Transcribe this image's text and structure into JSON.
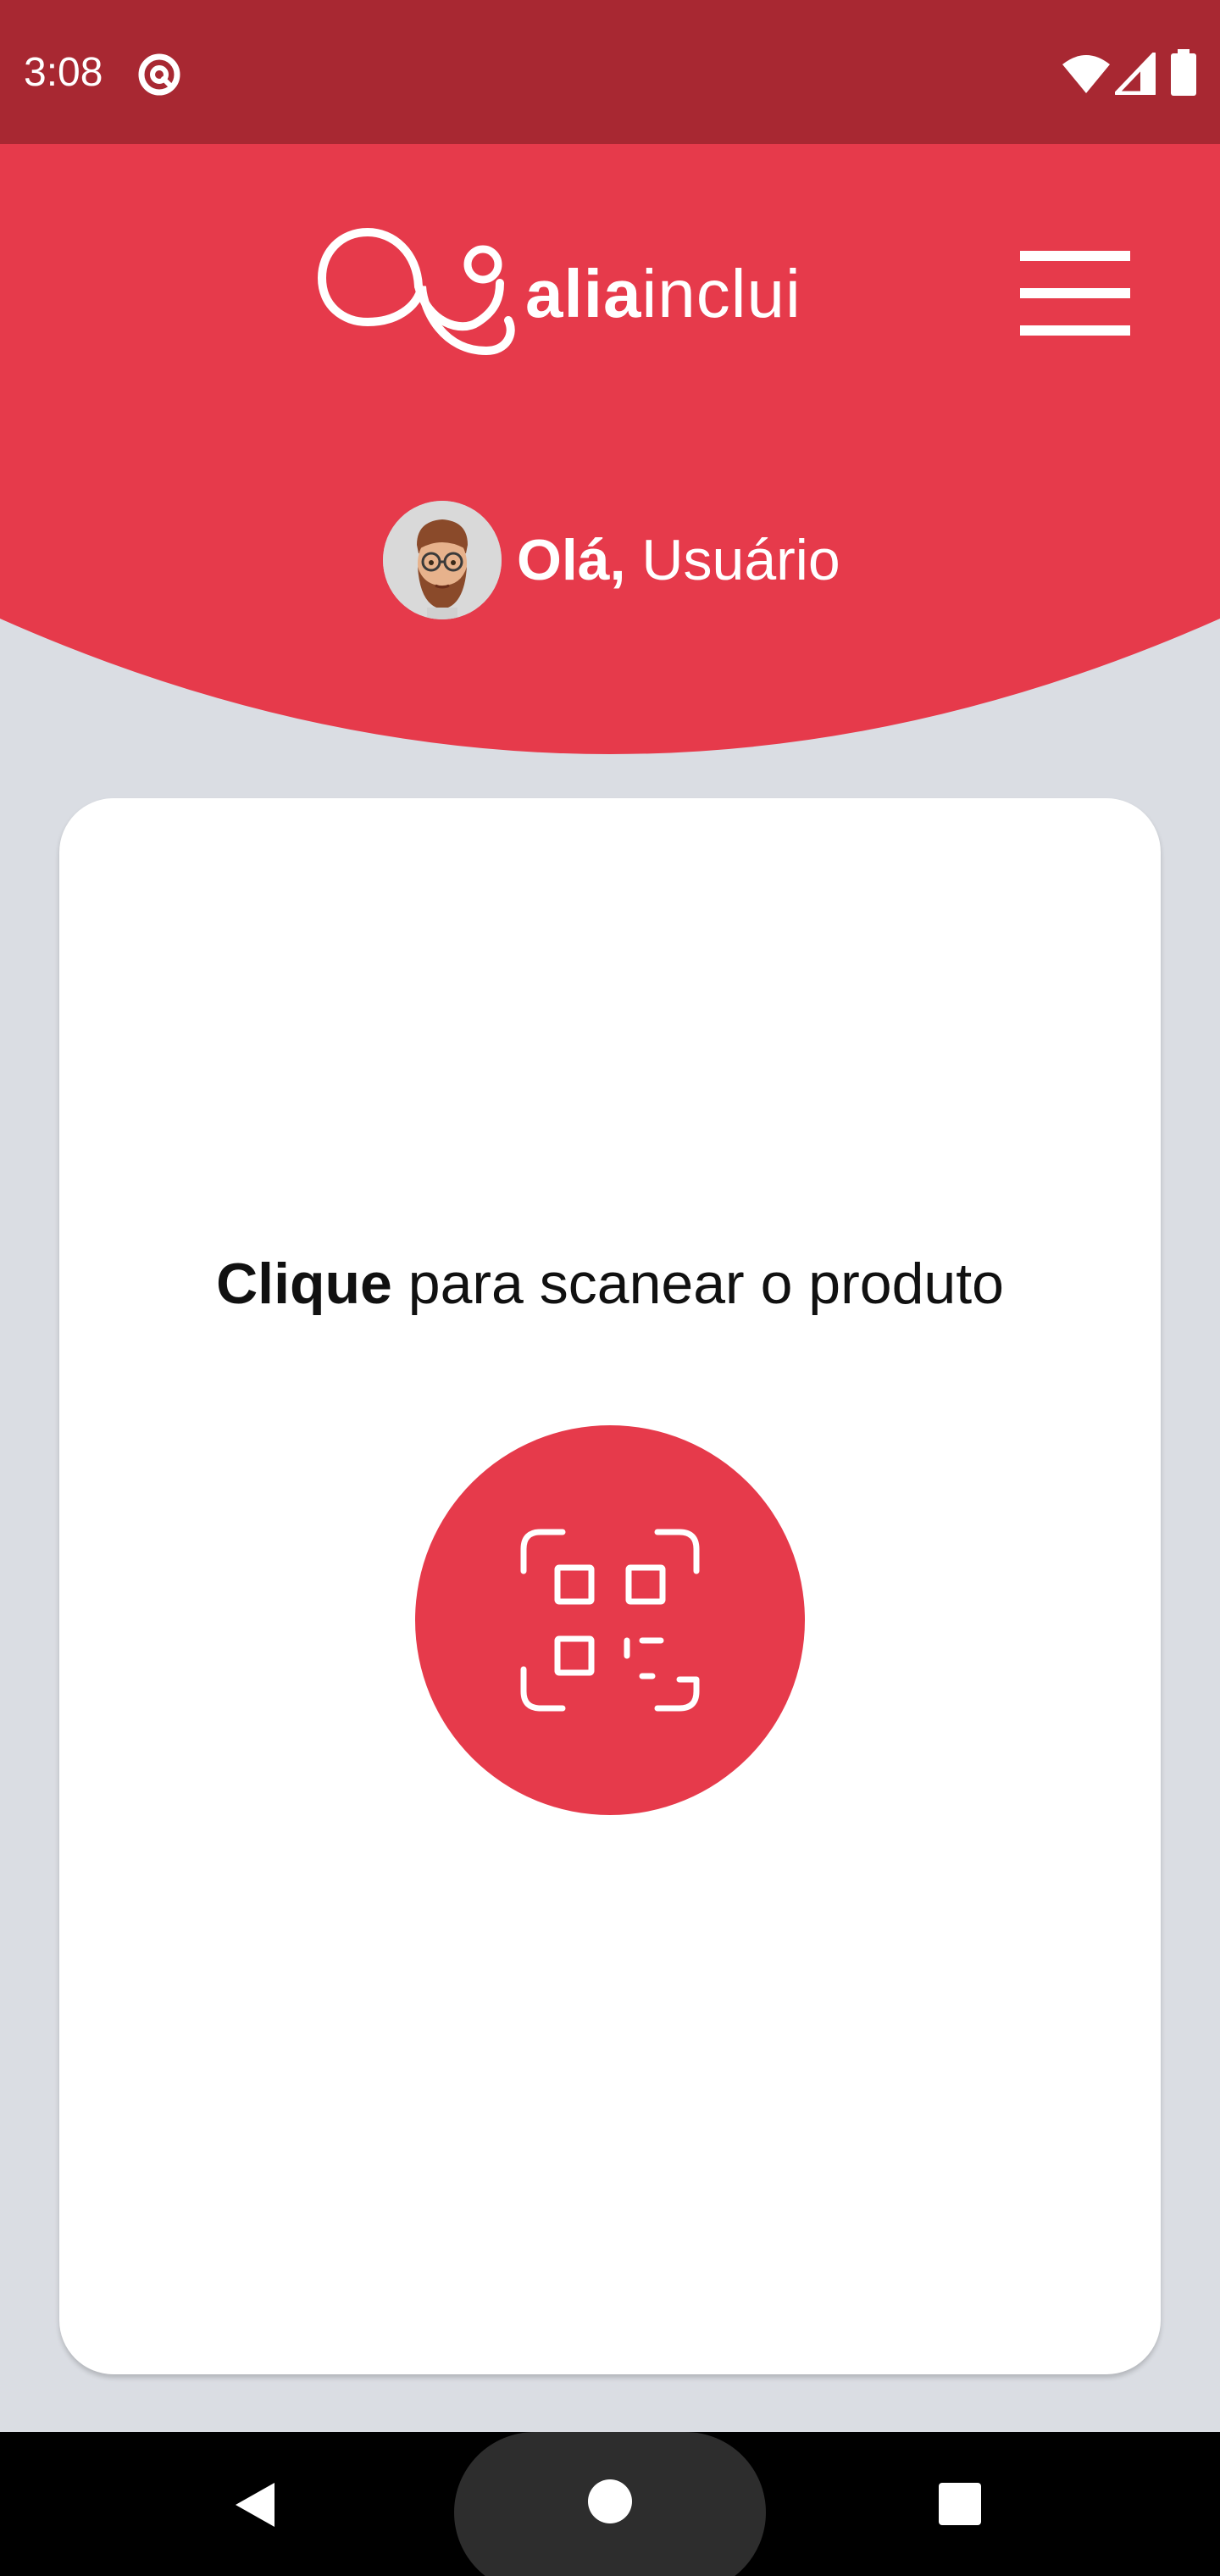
{
  "status_bar": {
    "time": "3:08",
    "background": "#a82832",
    "icons": [
      "do-not-disturb-icon",
      "wifi-icon",
      "signal-icon",
      "battery-icon"
    ]
  },
  "header": {
    "brand_bold": "alia",
    "brand_light": "inclui",
    "brand_color": "#e63a4b",
    "greeting_bold": "Olá,",
    "greeting_name": " Usuário"
  },
  "main": {
    "prompt_bold": "Clique",
    "prompt_rest": " para scanear o produto",
    "scan_icon": "qr-scan-icon",
    "accent": "#e63a4b"
  },
  "nav_bar": {
    "buttons": [
      "back-icon",
      "home-icon",
      "recents-icon"
    ]
  }
}
